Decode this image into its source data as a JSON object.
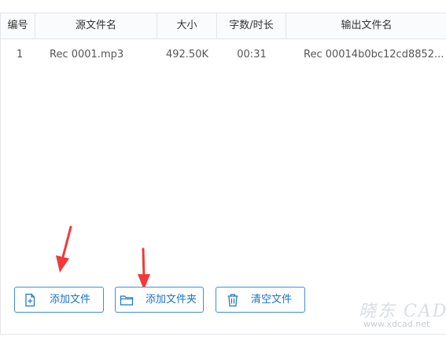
{
  "table": {
    "headers": [
      "编号",
      "源文件名",
      "大小",
      "字数/时长",
      "输出文件名"
    ],
    "rows": [
      [
        "1",
        "Rec 0001.mp3",
        "492.50K",
        "00:31",
        "Rec 00014b0bc12cd8852..."
      ]
    ]
  },
  "toolbar": {
    "add_file_label": "添加文件",
    "add_folder_label": "添加文件夹",
    "clear_label": "清空文件"
  },
  "watermark": {
    "logo_text": "晓东 CAD",
    "url": "www.xdcad.net"
  },
  "colors": {
    "accent": "#1a73c7",
    "button_border": "#3d8fd6",
    "arrow": "#f03a3a",
    "grid_line": "#e3e6ea"
  },
  "icons": {
    "add_file": "file-plus-icon",
    "add_folder": "folder-icon",
    "clear": "trash-icon",
    "annotation": "arrow-down-icon"
  }
}
